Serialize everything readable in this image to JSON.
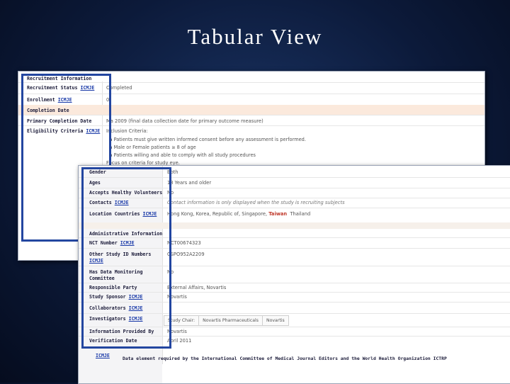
{
  "slide": {
    "title": "Tabular View"
  },
  "tag": "ICMJE",
  "shot1": {
    "section_header": "Recruitment Information",
    "recruitment_status": {
      "label": "Recruitment Status",
      "value": "Completed"
    },
    "enrollment": {
      "label": "Enrollment",
      "value": "0"
    },
    "completion_date": {
      "label": "Completion Date",
      "value": ""
    },
    "primary_completion_date": {
      "label": "Primary Completion Date",
      "value": "Ma 2009 (final data collection date for primary outcome measure)"
    },
    "eligibility": {
      "label": "Eligibility Criteria",
      "value": "Inclusion Criteria:",
      "bullets": [
        "Patients must give written informed consent before any assessment is performed.",
        "Male or Female patients ≥ 8 of age",
        "Patients willing and able to comply with all study procedures"
      ],
      "tail": "Focus on criteria for study eye."
    }
  },
  "shot2": {
    "rows": [
      {
        "label": "Gender",
        "value": "Both"
      },
      {
        "label": "Ages",
        "value": "18 Years and older"
      },
      {
        "label": "Accepts Healthy Volunteers",
        "value": "No"
      },
      {
        "label": "Contacts",
        "value": "Contact information is only displayed when the study is recruiting subjects"
      }
    ],
    "location": {
      "label": "Location Countries",
      "countries_before": "Hong Kong,  Korea, Republic of,  Singapore,",
      "highlight": "Taiwan",
      "countries_after": "Thailand"
    },
    "admin_header": "Administrative Information",
    "nct": {
      "label": "NCT Number",
      "value": "NCT00674323"
    },
    "other_ids": {
      "label": "Other Study ID Numbers",
      "value": "CSPO952A2209"
    },
    "dmc": {
      "label_line1": "Has Data Monitoring",
      "label_line2": "Committee",
      "value": "No"
    },
    "responsible": {
      "label": "Responsible Party",
      "value": "External Affairs, Novartis"
    },
    "sponsor": {
      "label": "Study Sponsor",
      "value": "Novartis"
    },
    "collaborators": {
      "label": "Collaborators"
    },
    "investigators": {
      "label": "Investigators",
      "tabs": [
        "Study Chair:",
        "Novartis Pharmaceuticals",
        "Novartis"
      ]
    },
    "provided_by": {
      "label": "Information Provided By",
      "value": "Novartis"
    },
    "verification": {
      "label": "Verification Date",
      "value": "April 2011"
    },
    "footer_note": "Data element required by the International Committee of Medical Journal Editors and the World Health Organization ICTRP"
  }
}
